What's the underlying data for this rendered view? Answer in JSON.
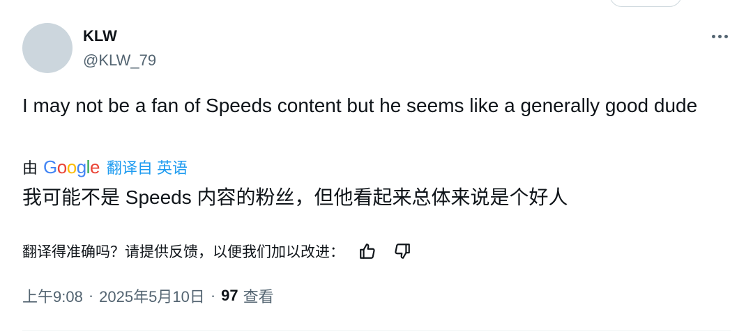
{
  "tweet": {
    "author_name": "KLW",
    "author_handle": "@KLW_79",
    "text": "I may not be a fan of Speeds content but he seems like a generally good dude",
    "translation": {
      "by_label": "由",
      "provider": "Google",
      "translated_from_label": "翻译自 英语",
      "text": "我可能不是 Speeds 内容的粉丝，但他看起来总体来说是个好人",
      "feedback_prompt": "翻译得准确吗？请提供反馈，以便我们加以改进："
    },
    "time": "上午9:08",
    "date": "2025年5月10日",
    "separator": "·",
    "views_count": "97",
    "views_label": "查看"
  },
  "icons": {
    "more": "more-horizontal-icon",
    "thumbs_up": "thumbs-up-icon",
    "thumbs_down": "thumbs-down-icon"
  },
  "colors": {
    "accent": "#1d9bf0",
    "secondary_text": "#536471",
    "avatar_placeholder": "#ccd6dd"
  }
}
